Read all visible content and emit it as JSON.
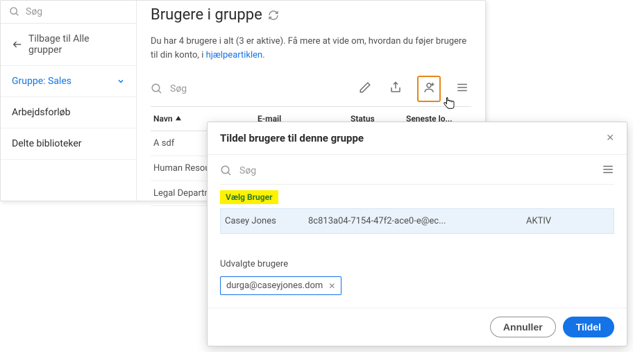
{
  "sidebar": {
    "search_placeholder": "Søg",
    "back_label": "Tilbage til Alle grupper",
    "group_label": "Gruppe: Sales",
    "items": [
      {
        "label": "Arbejdsforløb"
      },
      {
        "label": "Delte biblioteker"
      }
    ]
  },
  "page": {
    "title": "Brugere i gruppe",
    "description_prefix": "Du har 4 brugere i alt (3 er aktive). Få mere at vide om, hvordan du føjer brugere til din konto, i ",
    "help_link": "hjælpeartiklen",
    "description_suffix": "."
  },
  "toolbar": {
    "search_placeholder": "Søg"
  },
  "table": {
    "headers": {
      "name": "Navn",
      "email": "E-mail",
      "status": "Status",
      "login": "Seneste lo..."
    },
    "rows": [
      {
        "name": "A sdf"
      },
      {
        "name": "Human Resour"
      },
      {
        "name": "Legal Departm"
      }
    ]
  },
  "modal": {
    "title": "Tildel brugere til denne gruppe",
    "search_placeholder": "Søg",
    "select_user_label": "Vælg Bruger",
    "user": {
      "name": "Casey Jones",
      "email": "8c813a04-7154-47f2-ace0-e@ec...",
      "status": "AKTIV"
    },
    "selected_label": "Udvalgte brugere",
    "chip": "durga@caseyjones.dom",
    "cancel": "Annuller",
    "assign": "Tildel"
  }
}
